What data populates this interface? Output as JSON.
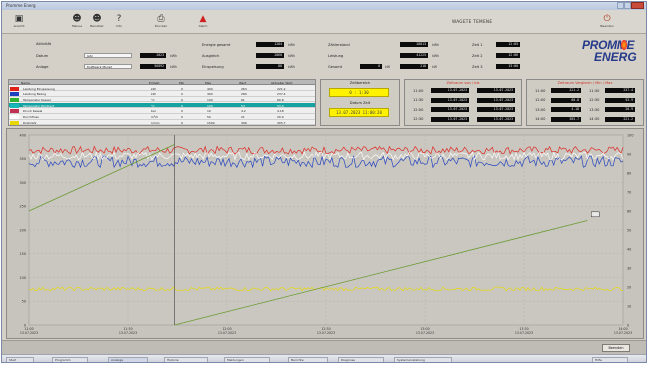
{
  "window": {
    "title": "Promme Energ"
  },
  "toolbar": {
    "title": "WAGETE TEMENE",
    "buttons": [
      {
        "label": "Ansicht",
        "icon": "monitor-icon"
      },
      {
        "label": "Menue",
        "icon": "person-icon"
      },
      {
        "label": "Benutzer",
        "icon": "person-icon"
      },
      {
        "label": "Info",
        "icon": "info-icon"
      },
      {
        "label": "Drucken",
        "icon": "printer-icon"
      },
      {
        "label": "Alarm",
        "icon": "alarm-icon"
      },
      {
        "label": "Beenden",
        "icon": "exit-icon"
      }
    ]
  },
  "params": {
    "c1": [
      {
        "label": "Aktivität",
        "input": "",
        "value": "",
        "unit": ""
      },
      {
        "label": "Datum",
        "input": "Jahr",
        "value": "2023",
        "unit": "kWh"
      },
      {
        "label": "Anlage",
        "input": "Kraftwerk Monet",
        "value": "56892",
        "unit": "kWh"
      }
    ],
    "c2": [
      {
        "label": "Energie gesamt",
        "value": "1284",
        "unit": "kWh"
      },
      {
        "label": "Ausgleich",
        "value": "2860",
        "unit": "kWh"
      },
      {
        "label": "Einspeisung",
        "value": "88",
        "unit": "kWh"
      }
    ],
    "c3": [
      {
        "label": "Zählerstand",
        "value": "28813",
        "unit": "kWh"
      },
      {
        "label": "Leistung",
        "value": "41225",
        "unit": "kWh"
      },
      {
        "label": "Gesamt",
        "value_a": "0",
        "unit_a": "kW",
        "value": "218",
        "unit": "kW"
      }
    ],
    "c4": [
      {
        "label": "Zeit 1",
        "value": "12:05"
      },
      {
        "label": "Zeit 2",
        "value": "12:06"
      },
      {
        "label": "Zeit 3",
        "value": "13:00"
      }
    ]
  },
  "logo": {
    "line1": "PROMME",
    "line2": "ENERG"
  },
  "legend": {
    "headers": [
      "Name",
      "Einheit",
      "Min",
      "Max",
      "Wert",
      "Aktueller Wert"
    ],
    "rows": [
      {
        "color": "#e0201a",
        "name": "Leistung Einspeisung",
        "unit": "kW",
        "min": "0",
        "max": "400",
        "val": "263",
        "cur": "221.2"
      },
      {
        "color": "#2040c0",
        "name": "Leistung Bezug",
        "unit": "kW",
        "min": "0",
        "max": "400",
        "val": "280",
        "cur": "237.4"
      },
      {
        "color": "#30b030",
        "name": "Temperatur Kessel",
        "unit": "°C",
        "min": "0",
        "max": "100",
        "val": "61",
        "cur": "60.8"
      },
      {
        "color": "#18b7b7",
        "name": "Temperatur Rücklauf",
        "unit": "°C",
        "min": "0",
        "max": "100",
        "val": "54",
        "cur": "53.9"
      },
      {
        "color": "#c03050",
        "name": "Druck Kessel",
        "unit": "bar",
        "min": "0",
        "max": "10",
        "val": "4.2",
        "cur": "4.18"
      },
      {
        "color": "#ffffff",
        "name": "Durchfluss",
        "unit": "m³/h",
        "min": "0",
        "max": "50",
        "val": "21",
        "cur": "20.9"
      },
      {
        "color": "#e8d800",
        "name": "Drehzahl",
        "unit": "1/min",
        "min": "0",
        "max": "1500",
        "val": "306",
        "cur": "305.7"
      }
    ]
  },
  "zeitbereich": {
    "title": "Zeitbereich",
    "value1": "0 : 1:30",
    "sub": "Datum Zeit",
    "value2": "13.07.2023 11:00:20"
  },
  "zeitraum1": {
    "title": "Zeitraum von / bis",
    "rows": [
      {
        "l": "11:00",
        "v1": "13.07.2023",
        "v2": "13.07.2023"
      },
      {
        "l": "11:30",
        "v1": "13.07.2023",
        "v2": "13.07.2023"
      },
      {
        "l": "12:00",
        "v1": "13.07.2023",
        "v2": "13.07.2023"
      },
      {
        "l": "12:30",
        "v1": "13.07.2023",
        "v2": "13.07.2023"
      }
    ]
  },
  "zeitraum2": {
    "title": "Zeitraum Vergleich / Min / Max",
    "rows": [
      {
        "l1": "11:00",
        "v1": "221.2",
        "l2": "11:30",
        "v2": "237.4"
      },
      {
        "l1": "12:00",
        "v1": "60.8",
        "l2": "12:30",
        "v2": "53.9"
      },
      {
        "l1": "13:00",
        "v1": "4.18",
        "l2": "13:30",
        "v2": "20.9"
      },
      {
        "l1": "14:00",
        "v1": "305.7",
        "l2": "14:30",
        "v2": "221.2"
      }
    ]
  },
  "chart_data": {
    "type": "line",
    "x_ticks": [
      "11:00\n13.07.2023",
      "11:30\n13.07.2023",
      "12:00\n13.07.2023",
      "12:30\n13.07.2023",
      "13:00\n13.07.2023",
      "13:30\n13.07.2023",
      "14:00\n13.07.2023"
    ],
    "y_left_ticks": [
      "400",
      "350",
      "300",
      "250",
      "200",
      "150",
      "100",
      "50",
      "0"
    ],
    "y_right_ticks": [
      "100",
      "90",
      "80",
      "70",
      "60",
      "50",
      "40",
      "30",
      "20",
      "10",
      "0"
    ],
    "cursor_label": "12:00",
    "grid": true,
    "legend": "none",
    "series": [
      {
        "color": "#e0201a",
        "noisy": true,
        "level": 0.92,
        "amp": 0.02
      },
      {
        "color": "#2040c0",
        "noisy": true,
        "level": 0.86,
        "amp": 0.03
      },
      {
        "color": "#ffffff",
        "noisy": true,
        "level": 0.89,
        "amp": 0.02
      },
      {
        "color": "#e8d800",
        "noisy": true,
        "level": 0.19,
        "amp": 0.01
      },
      {
        "color": "#6a9a30",
        "noisy": false,
        "points": [
          [
            0.0,
            0.6
          ],
          [
            0.245,
            0.95
          ]
        ]
      },
      {
        "color": "#6a9a30",
        "noisy": false,
        "points": [
          [
            0.245,
            0.0
          ],
          [
            0.94,
            0.55
          ]
        ]
      }
    ]
  },
  "status": {
    "ok_label": "Beenden"
  },
  "taskbar": {
    "items": [
      "Start",
      "Programm",
      "Anzeige",
      "Historie",
      "Meldungen",
      "Berichte",
      "Diagnose",
      "Systemeinstellung",
      "Hilfe"
    ],
    "clock": "14:23"
  }
}
